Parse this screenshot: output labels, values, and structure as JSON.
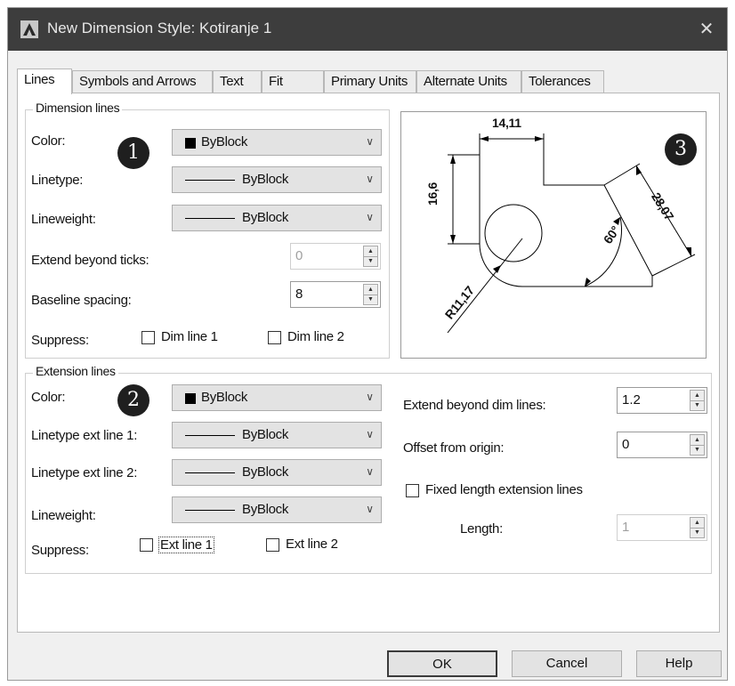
{
  "window": {
    "title": "New Dimension Style: Kotiranje 1",
    "close_glyph": "✕"
  },
  "tabs": [
    "Lines",
    "Symbols and Arrows",
    "Text",
    "Fit",
    "Primary Units",
    "Alternate Units",
    "Tolerances"
  ],
  "dimension_lines": {
    "legend": "Dimension lines",
    "badge": "1",
    "color_label": "Color:",
    "color_value": "ByBlock",
    "linetype_label": "Linetype:",
    "linetype_value": "ByBlock",
    "lineweight_label": "Lineweight:",
    "lineweight_value": "ByBlock",
    "extend_ticks_label": "Extend beyond ticks:",
    "extend_ticks_value": "0",
    "baseline_label": "Baseline spacing:",
    "baseline_value": "8",
    "suppress_label": "Suppress:",
    "dim_line1_label": "Dim line 1",
    "dim_line2_label": "Dim line 2"
  },
  "extension_lines": {
    "legend": "Extension lines",
    "badge": "2",
    "color_label": "Color:",
    "color_value": "ByBlock",
    "linetype1_label": "Linetype ext line 1:",
    "linetype1_value": "ByBlock",
    "linetype2_label": "Linetype ext line 2:",
    "linetype2_value": "ByBlock",
    "lineweight_label": "Lineweight:",
    "lineweight_value": "ByBlock",
    "suppress_label": "Suppress:",
    "ext_line1_label": "Ext line 1",
    "ext_line2_label": "Ext line 2",
    "extend_beyond_label": "Extend beyond dim lines:",
    "extend_beyond_value": "1.2",
    "offset_label": "Offset from origin:",
    "offset_value": "0",
    "fixed_length_label": "Fixed length extension lines",
    "length_label": "Length:",
    "length_value": "1"
  },
  "preview": {
    "badge": "3",
    "dim_top": "14,11",
    "dim_left": "16,6",
    "dim_right": "28,07",
    "dim_angle": "60°",
    "dim_radius": "R11,17"
  },
  "buttons": {
    "ok": "OK",
    "cancel": "Cancel",
    "help": "Help"
  },
  "colors": {
    "titlebar": "#3d3d3d",
    "badge": "#1f1f1f",
    "panel": "#ffffff",
    "dialog": "#f0f0f0"
  }
}
